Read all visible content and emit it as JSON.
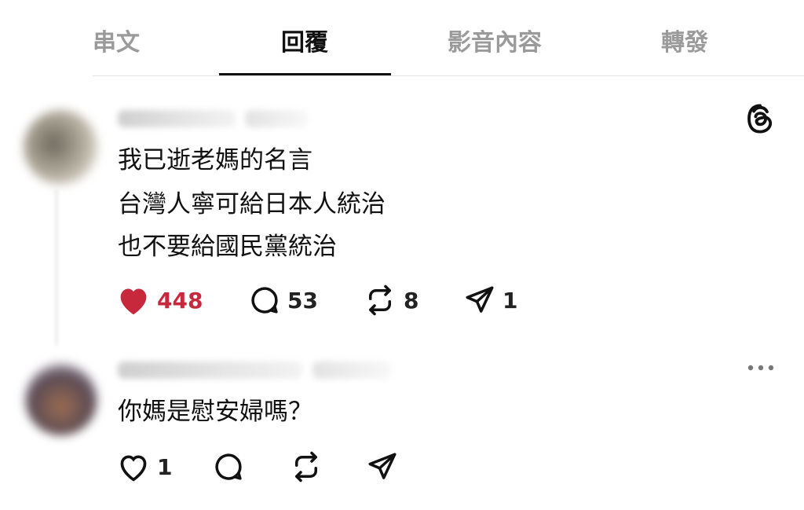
{
  "tabs": [
    {
      "label": "串文",
      "active": false
    },
    {
      "label": "回覆",
      "active": true
    },
    {
      "label": "影音內容",
      "active": false
    },
    {
      "label": "轉發",
      "active": false
    }
  ],
  "post": {
    "lines": [
      "我已逝老媽的名言",
      "台灣人寧可給日本人統治",
      "也不要給國民黨統治"
    ],
    "likes": "448",
    "liked": true,
    "comments": "53",
    "reposts": "8",
    "shares": "1"
  },
  "reply": {
    "text": "你媽是慰安婦嗎？",
    "likes": "1"
  },
  "colors": {
    "like_red": "#c8283c",
    "inactive_tab": "#9a9a9a"
  },
  "icons": [
    "threads-logo-icon",
    "heart-icon",
    "comment-icon",
    "repost-icon",
    "share-icon",
    "more-icon"
  ]
}
